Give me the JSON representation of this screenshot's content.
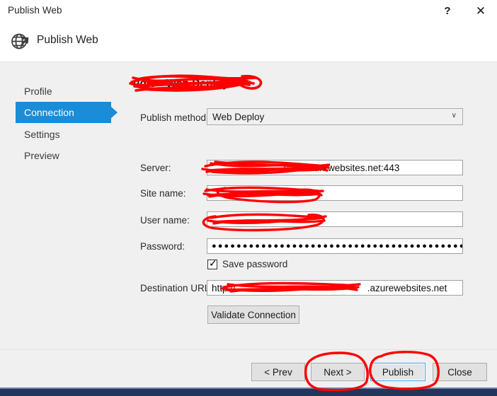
{
  "window": {
    "title": "Publish Web",
    "help_button": "?",
    "close_button": "✕"
  },
  "header": {
    "icon": "publish-globe-icon",
    "title": "Publish Web"
  },
  "sidebar": {
    "items": [
      {
        "label": "Profile",
        "selected": false
      },
      {
        "label": "Connection",
        "selected": true
      },
      {
        "label": "Settings",
        "selected": false
      },
      {
        "label": "Preview",
        "selected": false
      }
    ]
  },
  "main": {
    "panel_title": "udio - Web Deploy *",
    "panel_title_redacted": true,
    "publish_method": {
      "label": "Publish method:",
      "value": "Web Deploy",
      "chevron": "∨"
    },
    "fields": [
      {
        "label": "Server:",
        "value": ".scm.azurewebsites.net:443",
        "redacted": true
      },
      {
        "label": "Site name:",
        "value": "",
        "redacted": true
      },
      {
        "label": "User name:",
        "value": "",
        "redacted": true
      }
    ],
    "password": {
      "label": "Password:",
      "value": "●●●●●●●●●●●●●●●●●●●●●●●●●●●●●●●●●●●●●●●●●●●●●●●●●●●●●●●●●●"
    },
    "save_password": {
      "label": "Save password",
      "checked": true,
      "check_glyph": "✓"
    },
    "destination_url": {
      "label": "Destination URL:",
      "value": "http://",
      "value_suffix": ".azurewebsites.net",
      "redacted": true
    },
    "validate_button": "Validate Connection"
  },
  "footer": {
    "prev_button": "< Prev",
    "next_button": "Next >",
    "publish_button": "Publish",
    "close_button": "Close"
  },
  "annotations": {
    "color": "#fe0000",
    "marks": [
      "scribble-over-panel-title",
      "scribble-over-server-value",
      "scribble-over-site-name-value",
      "scribble-over-user-name-value",
      "scribble-over-destination-url-value",
      "circle-around-next-button",
      "circle-around-publish-button"
    ]
  },
  "colors": {
    "dialog_background": "#f0f0f0",
    "titlebar_background": "#ffffff",
    "sidebar_selected": "#1a8cd8",
    "focus_border": "#4aa3e0",
    "taskbar": "#24355b",
    "annotation_red": "#fe0000"
  }
}
